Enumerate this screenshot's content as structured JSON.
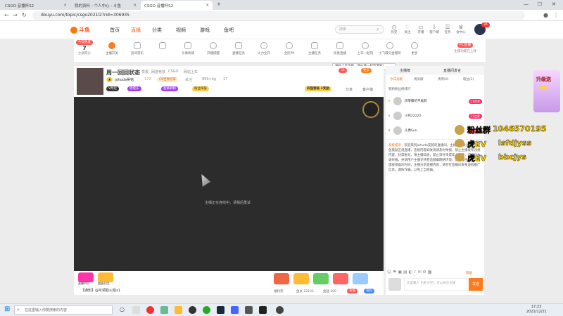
{
  "browser": {
    "tabs": [
      {
        "title": "CSGO 音播杯S2",
        "active": false
      },
      {
        "title": "我的资料 - 个人中心 - 斗鱼",
        "active": false
      },
      {
        "title": "CSGO 音播杯S2",
        "active": true
      }
    ],
    "url": "douyu.com/topic/csgo2021l2?rid=306935"
  },
  "site": {
    "logo_text": "斗鱼",
    "nav": [
      "首页",
      "直播",
      "分类",
      "视频",
      "游戏",
      "鱼吧"
    ],
    "search_placeholder": "搜索",
    "header_icons": [
      "历史",
      "关注",
      "开播",
      "客户端",
      "任务",
      "会中心"
    ],
    "avatar_count": "36"
  },
  "toolbar": {
    "left_label": "今日热度",
    "left_value": "7",
    "left_sub": "主播积分",
    "items": [
      "主播开关",
      "房间音乐",
      "",
      "头像商城",
      "开播提醒",
      "直播任务",
      "火力全开",
      "全民PK",
      "主播任务",
      "民意直播",
      "上车一起玩",
      "小飞碟分金赠奖",
      "更多"
    ],
    "right_button": "PC直播",
    "right_sub": "主播功能已上线"
  },
  "tooltip": "开始上车功能，等伙伴一起玩游戏！",
  "room": {
    "title": "周一回回状态",
    "badge": "举报",
    "breadcrumb": [
      "网游竞技",
      "CSGO",
      "网站上车"
    ],
    "anchor_name": "jahuda昊铭",
    "level": "172",
    "hot_label": "CS世界冠军",
    "follow": "关注",
    "followers": "999+kg",
    "online": "17",
    "tags": [
      "V附近",
      "摇摇乐",
      "超级刷粉",
      "粉丝荣誉"
    ],
    "activity_tag": "四强晋级·1奖励",
    "share": "分享",
    "report": "客户端",
    "more": "更多",
    "sub_count": "35"
  },
  "player": {
    "loading_text": "主播正在连线中，请稍后重试"
  },
  "player_bottom": {
    "gifts": [
      "直播节目",
      "超级礼包"
    ],
    "input_placeholder": "【通知】@可领取火箭x1",
    "stats": [
      "福利券",
      "鱼丸 22133",
      "鱼翅 200"
    ],
    "recharge": "充值",
    "send": "背包",
    "right_gifts": [
      "荧光棒",
      "办卡",
      "鱼丸",
      "鱼翅",
      "加油"
    ]
  },
  "sidebar": {
    "tabs_top": [
      "主播榜",
      "贵族"
    ],
    "tab_right": "直播间发言",
    "subtabs": [
      "今日贡献",
      "周贡献",
      "贵宾(0)",
      "粉丝(2)"
    ],
    "rank_title": "铁粉粉丝榜排行",
    "ranks": [
      {
        "name": "风零蝶的平尾鸦",
        "badge": "CS世界"
      },
      {
        "name": "小鸡22222",
        "badge": "CS世界"
      },
      {
        "name": "头像Sun",
        "badge": "CS世界"
      }
    ],
    "notice_label": "系统提示：",
    "notice_text": "欢迎来到jahuda昊铭的直播间，主播为热关注他，斗鱼鼓励正规直播，违规内容如发现请及时举报，禁止主播发布违规内容，封禁账号，请主播知悉；禁止诱导未成年人消费，不良行为请举报，并请用户主播支持营造健康网络环境；禁止理性消费，合理安排娱乐时间，主播分享直播内容，请勿在直播间发布虚假推广信息，谨防诈骗，以免上当受骗。",
    "input_placeholder": "这里输入'#关注'吧，可以关注主播",
    "send_button": "发送",
    "level_label": "等级"
  },
  "fan_panel": {
    "title_prefix": "粉丝群",
    "title_number": "1046570195",
    "lines": [
      {
        "name": "虎EV",
        "value": "lsfdjyss"
      },
      {
        "name": "虎EV",
        "value": "bbcjys"
      }
    ],
    "promo": "升级送",
    "promo2": "鱼丸"
  },
  "taskbar": {
    "search_placeholder": "在这里输入你要搜索的内容",
    "time": "17:23",
    "date": "2021/12/21"
  },
  "colors": {
    "brand": "#ff5d23",
    "player_bg": "#2c2c2c"
  }
}
